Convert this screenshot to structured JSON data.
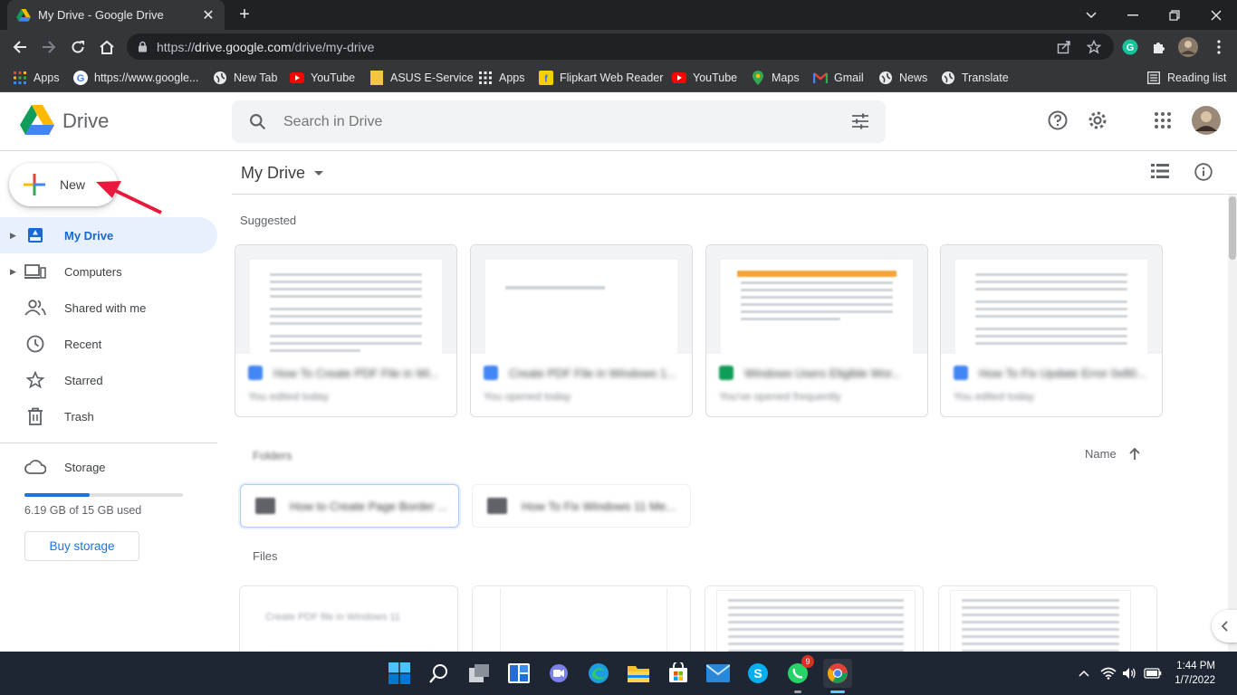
{
  "browser": {
    "tab_title": "My Drive - Google Drive",
    "tab_close": "✕",
    "new_tab": "+",
    "url_prefix": "https://",
    "url_host": "drive.google.com",
    "url_path": "/drive/my-drive",
    "bookmarks": [
      {
        "label": "Apps",
        "icon": "apps-grid-icon"
      },
      {
        "label": "https://www.google...",
        "icon": "google-icon"
      },
      {
        "label": "New Tab",
        "icon": "globe-icon"
      },
      {
        "label": "YouTube",
        "icon": "youtube-icon"
      },
      {
        "label": "ASUS E-Service",
        "icon": "bookmark-folder-icon"
      },
      {
        "label": "Apps",
        "icon": "apps-grid-icon"
      },
      {
        "label": "Flipkart Web Reader",
        "icon": "flipkart-icon"
      },
      {
        "label": "YouTube",
        "icon": "youtube-icon"
      },
      {
        "label": "Maps",
        "icon": "maps-pin-icon"
      },
      {
        "label": "Gmail",
        "icon": "gmail-icon"
      },
      {
        "label": "News",
        "icon": "globe-icon"
      },
      {
        "label": "Translate",
        "icon": "globe-icon"
      }
    ],
    "reading_list": "Reading list"
  },
  "drive": {
    "logo_text": "Drive",
    "search_placeholder": "Search in Drive",
    "new_label": "New",
    "nav": [
      {
        "label": "My Drive",
        "icon": "my-drive-icon",
        "active": true
      },
      {
        "label": "Computers",
        "icon": "computers-icon"
      },
      {
        "label": "Shared with me",
        "icon": "shared-icon"
      },
      {
        "label": "Recent",
        "icon": "clock-icon"
      },
      {
        "label": "Starred",
        "icon": "star-icon"
      },
      {
        "label": "Trash",
        "icon": "trash-icon"
      }
    ],
    "storage_label": "Storage",
    "storage_used_text": "6.19 GB of 15 GB used",
    "storage_used_fraction": 0.413,
    "buy_storage": "Buy storage",
    "main_title": "My Drive",
    "suggested_label": "Suggested",
    "suggested": [
      {
        "name": "How To Create PDF File in Wi...",
        "sub": "You edited today",
        "type_color": "#4285f4"
      },
      {
        "name": "Create PDF File in Windows 1...",
        "sub": "You opened today",
        "type_color": "#4285f4"
      },
      {
        "name": "Windows Users Eligible Wor...",
        "sub": "You've opened frequently",
        "type_color": "#0f9d58"
      },
      {
        "name": "How To Fix Update Error 0x80...",
        "sub": "You edited today",
        "type_color": "#4285f4"
      }
    ],
    "folders_label": "Folders",
    "sort_label": "Name",
    "folders": [
      {
        "name": "How to Create Page Border ..."
      },
      {
        "name": "How To Fix Windows 11 Me..."
      }
    ],
    "files_label": "Files",
    "files": [
      {
        "preview": "Create PDF file in Windows 11"
      },
      {
        "preview": ""
      },
      {
        "preview": ""
      },
      {
        "preview": ""
      }
    ]
  },
  "taskbar": {
    "time": "1:44 PM",
    "date": "1/7/2022",
    "whatsapp_badge": "9"
  },
  "colors": {
    "accent": "#1a73e8",
    "active_nav_bg": "#e8f0fe",
    "chrome_dark": "#202124",
    "taskbar": "#1f2633"
  }
}
